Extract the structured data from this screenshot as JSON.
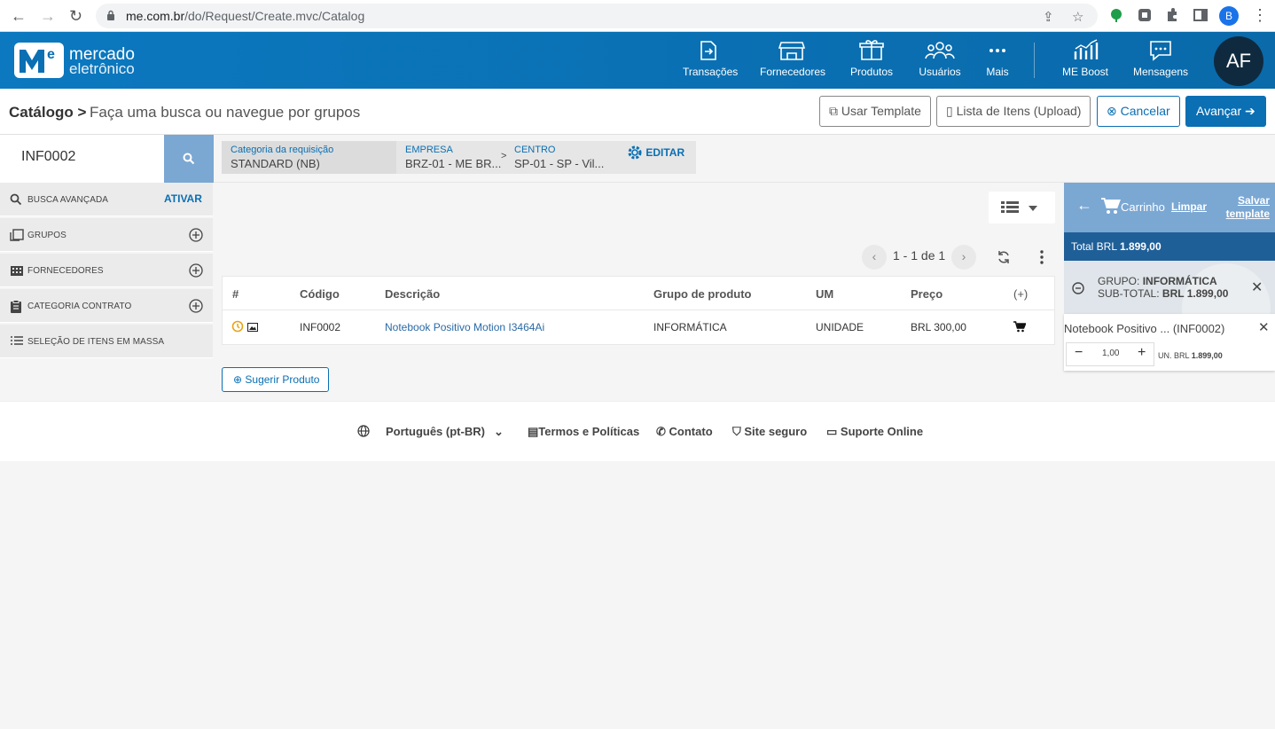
{
  "browser": {
    "url_domain": "me.com.br",
    "url_path": "/do/Request/Create.mvc/Catalog",
    "profile_letter": "B"
  },
  "header": {
    "logo_line1": "mercado",
    "logo_line2": "eletrônico",
    "menu": [
      {
        "label": "Transações",
        "icon": "transactions-icon"
      },
      {
        "label": "Fornecedores",
        "icon": "store-icon"
      },
      {
        "label": "Produtos",
        "icon": "box-icon"
      },
      {
        "label": "Usuários",
        "icon": "users-icon"
      },
      {
        "label": "Mais",
        "icon": "more-icon"
      },
      {
        "label": "ME Boost",
        "icon": "chart-icon"
      },
      {
        "label": "Mensagens",
        "icon": "chat-icon"
      }
    ],
    "avatar": "AF",
    "brand_color": "#0a6fb3"
  },
  "titlebar": {
    "title": "Catálogo >",
    "subtitle": "Faça uma busca ou navegue por grupos",
    "btn_template": "Usar Template",
    "btn_upload": "Lista de Itens (Upload)",
    "btn_cancel": "Cancelar",
    "btn_next": "Avançar"
  },
  "search": {
    "value": "INF0002"
  },
  "sidebar": {
    "busca": "BUSCA AVANÇADA",
    "ativar": "ATIVAR",
    "items": [
      {
        "label": "GRUPOS"
      },
      {
        "label": "FORNECEDORES"
      },
      {
        "label": "CATEGORIA CONTRATO"
      },
      {
        "label": "SELEÇÃO DE ITENS EM MASSA"
      }
    ]
  },
  "filters": {
    "categoria_label": "Categoria da requisição",
    "categoria_value": "STANDARD (NB)",
    "empresa_label": "EMPRESA",
    "empresa_value": "BRZ-01 - ME BR...",
    "sep": ">",
    "centro_label": "CENTRO",
    "centro_value": "SP-01 - SP - Vil...",
    "editar": "EDITAR"
  },
  "pager": {
    "text": "1 - 1 de 1"
  },
  "table": {
    "headers": [
      "#",
      "Código",
      "Descrição",
      "Grupo de produto",
      "UM",
      "Preço",
      "(+)"
    ],
    "rows": [
      {
        "codigo": "INF0002",
        "descricao": "Notebook Positivo Motion I3464Ai",
        "grupo": "INFORMÁTICA",
        "um": "UNIDADE",
        "preco": "BRL 300,00"
      }
    ]
  },
  "sugerir": "Sugerir Produto",
  "cart": {
    "title": "Carrinho",
    "limpar": "Limpar",
    "salvar_line1": "Salvar",
    "salvar_line2": "template",
    "total_label": "Total BRL",
    "total_value": "1.899,00",
    "group_label": "GRUPO:",
    "group_value": "INFORMÁTICA",
    "subtotal_label": "SUB-TOTAL:",
    "subtotal_value": "BRL 1.899,00",
    "item_name": "Notebook Positivo ... (INF0002)",
    "qty": "1,00",
    "un_label": "UN. BRL",
    "un_value": "1.899,00"
  },
  "footer": {
    "language": "Português (pt-BR)",
    "terms": "Termos e Políticas",
    "contact": "Contato",
    "secure": "Site seguro",
    "support": "Suporte Online"
  }
}
